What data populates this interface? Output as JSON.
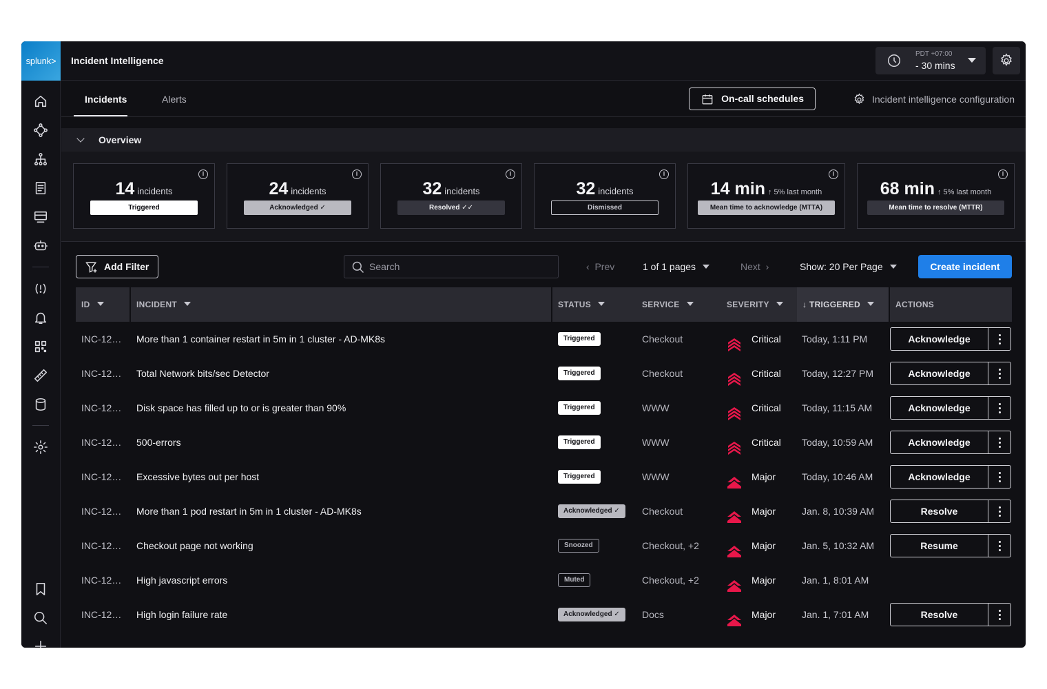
{
  "app": {
    "logo": "splunk>",
    "title": "Incident Intelligence"
  },
  "time_picker": {
    "timezone": "PDT +07:00",
    "range": "- 30 mins"
  },
  "tabs": [
    {
      "label": "Incidents",
      "active": true
    },
    {
      "label": "Alerts",
      "active": false
    }
  ],
  "header_actions": {
    "oncall": "On-call schedules",
    "config": "Incident intelligence configuration"
  },
  "overview": {
    "label": "Overview"
  },
  "kpis": [
    {
      "value": "14",
      "unit": "incidents",
      "sub": "",
      "label": "Triggered"
    },
    {
      "value": "24",
      "unit": "incidents",
      "sub": "",
      "label": "Acknowledged ✓"
    },
    {
      "value": "32",
      "unit": "incidents",
      "sub": "",
      "label": "Resolved ✓✓"
    },
    {
      "value": "32",
      "unit": "incidents",
      "sub": "",
      "label": "Dismissed"
    },
    {
      "value": "14 min",
      "unit": "",
      "sub": "↑ 5% last month",
      "label": "Mean time to acknowledge (MTTA)"
    },
    {
      "value": "68 min",
      "unit": "",
      "sub": "↑ 5% last month",
      "label": "Mean time to resolve (MTTR)"
    }
  ],
  "toolbar": {
    "add_filter": "Add Filter",
    "search_placeholder": "Search",
    "prev": "Prev",
    "page": "1 of 1 pages",
    "next": "Next",
    "per_page": "Show: 20 Per Page",
    "create": "Create incident"
  },
  "table": {
    "headers": {
      "id": "ID",
      "incident": "INCIDENT",
      "status": "STATUS",
      "service": "SERVICE",
      "severity": "SEVERITY",
      "triggered": "TRIGGERED",
      "actions": "ACTIONS"
    },
    "rows": [
      {
        "id": "INC-12…",
        "incident": "More than 1 container restart in 5m in 1 cluster - AD-MK8s",
        "status": "Triggered",
        "service": "Checkout",
        "severity": "Critical",
        "triggered": "Today, 1:11 PM",
        "action": "Acknowledge"
      },
      {
        "id": "INC-12…",
        "incident": "Total Network bits/sec Detector",
        "status": "Triggered",
        "service": "Checkout",
        "severity": "Critical",
        "triggered": "Today, 12:27 PM",
        "action": "Acknowledge"
      },
      {
        "id": "INC-12…",
        "incident": "Disk space has filled up to or is greater than 90%",
        "status": "Triggered",
        "service": "WWW",
        "severity": "Critical",
        "triggered": "Today, 11:15 AM",
        "action": "Acknowledge"
      },
      {
        "id": "INC-12…",
        "incident": "500-errors",
        "status": "Triggered",
        "service": "WWW",
        "severity": "Critical",
        "triggered": "Today, 10:59 AM",
        "action": "Acknowledge"
      },
      {
        "id": "INC-12…",
        "incident": "Excessive bytes out per host",
        "status": "Triggered",
        "service": "WWW",
        "severity": "Major",
        "triggered": "Today, 10:46 AM",
        "action": "Acknowledge"
      },
      {
        "id": "INC-12…",
        "incident": "More than 1 pod restart in 5m in 1 cluster - AD-MK8s",
        "status": "Acknowledged ✓",
        "service": "Checkout",
        "severity": "Major",
        "triggered": "Jan. 8, 10:39 AM",
        "action": "Resolve"
      },
      {
        "id": "INC-12…",
        "incident": "Checkout page not working",
        "status": "Snoozed",
        "service": "Checkout, +2",
        "severity": "Major",
        "triggered": "Jan. 5, 10:32 AM",
        "action": "Resume"
      },
      {
        "id": "INC-12…",
        "incident": "High javascript errors",
        "status": "Muted",
        "service": "Checkout, +2",
        "severity": "Major",
        "triggered": "Jan. 1, 8:01 AM",
        "action": ""
      },
      {
        "id": "INC-12…",
        "incident": "High login failure rate",
        "status": "Acknowledged ✓",
        "service": "Docs",
        "severity": "Major",
        "triggered": "Jan. 1, 7:01 AM",
        "action": "Resolve"
      }
    ]
  },
  "colors": {
    "accent": "#1f7fe8",
    "severity": "#e8174a",
    "background": "#101014"
  }
}
